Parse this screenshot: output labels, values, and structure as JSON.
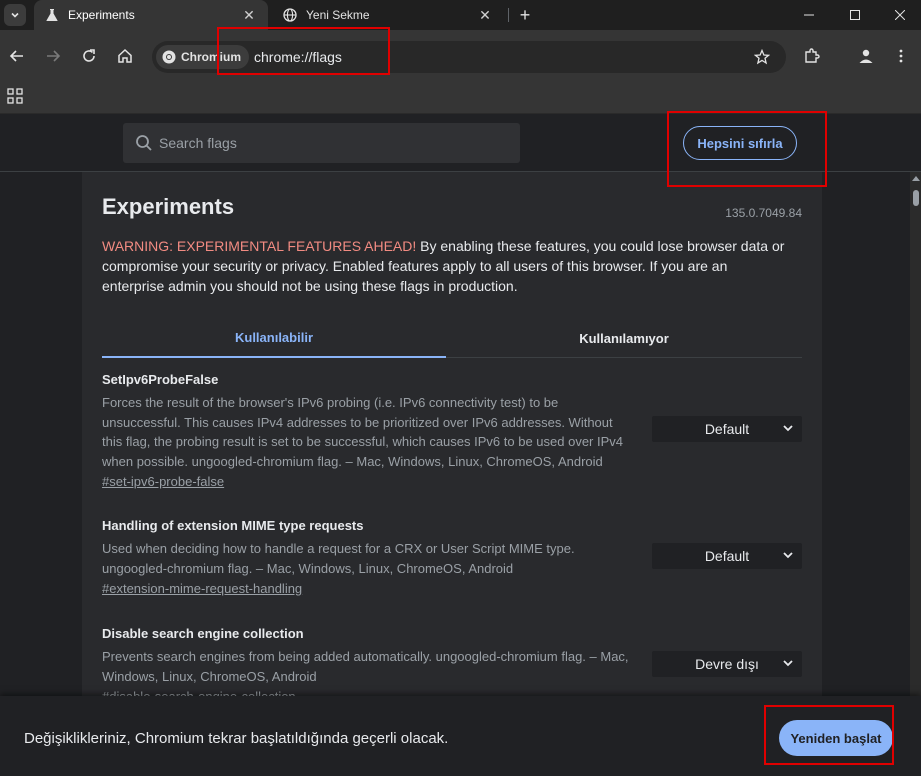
{
  "window": {
    "tabs": [
      {
        "title": "Experiments",
        "active": true
      },
      {
        "title": "Yeni Sekme",
        "active": false
      }
    ],
    "new_tab_label": "+"
  },
  "toolbar": {
    "chip_label": "Chromium",
    "url": "chrome://flags"
  },
  "flags_header": {
    "search_placeholder": "Search flags",
    "reset_all_label": "Hepsini sıfırla"
  },
  "page": {
    "title": "Experiments",
    "version": "135.0.7049.84",
    "warning_strong": "WARNING: EXPERIMENTAL FEATURES AHEAD!",
    "warning_text": " By enabling these features, you could lose browser data or compromise your security or privacy. Enabled features apply to all users of this browser. If you are an enterprise admin you should not be using these flags in production.",
    "tabs": [
      {
        "label": "Kullanılabilir",
        "active": true
      },
      {
        "label": "Kullanılamıyor",
        "active": false
      }
    ]
  },
  "flags": [
    {
      "name": "SetIpv6ProbeFalse",
      "description": "Forces the result of the browser's IPv6 probing (i.e. IPv6 connectivity test) to be unsuccessful. This causes IPv4 addresses to be prioritized over IPv6 addresses. Without this flag, the probing result is set to be successful, which causes IPv6 to be used over IPv4 when possible. ungoogled-chromium flag. – Mac, Windows, Linux, ChromeOS, Android",
      "link": "#set-ipv6-probe-false",
      "value": "Default"
    },
    {
      "name": "Handling of extension MIME type requests",
      "description": "Used when deciding how to handle a request for a CRX or User Script MIME type. ungoogled-chromium flag. – Mac, Windows, Linux, ChromeOS, Android",
      "link": "#extension-mime-request-handling",
      "value": "Default"
    },
    {
      "name": "Disable search engine collection",
      "description": "Prevents search engines from being added automatically. ungoogled-chromium flag. – Mac, Windows, Linux, ChromeOS, Android",
      "link": "#disable-search-engine-collection",
      "value": "Devre dışı"
    }
  ],
  "relaunch": {
    "message": "Değişiklikleriniz, Chromium tekrar başlatıldığında geçerli olacak.",
    "button_label": "Yeniden başlat"
  },
  "colors": {
    "accent": "#8ab4f8",
    "warning": "#f28b82",
    "highlight": "#e00000"
  }
}
